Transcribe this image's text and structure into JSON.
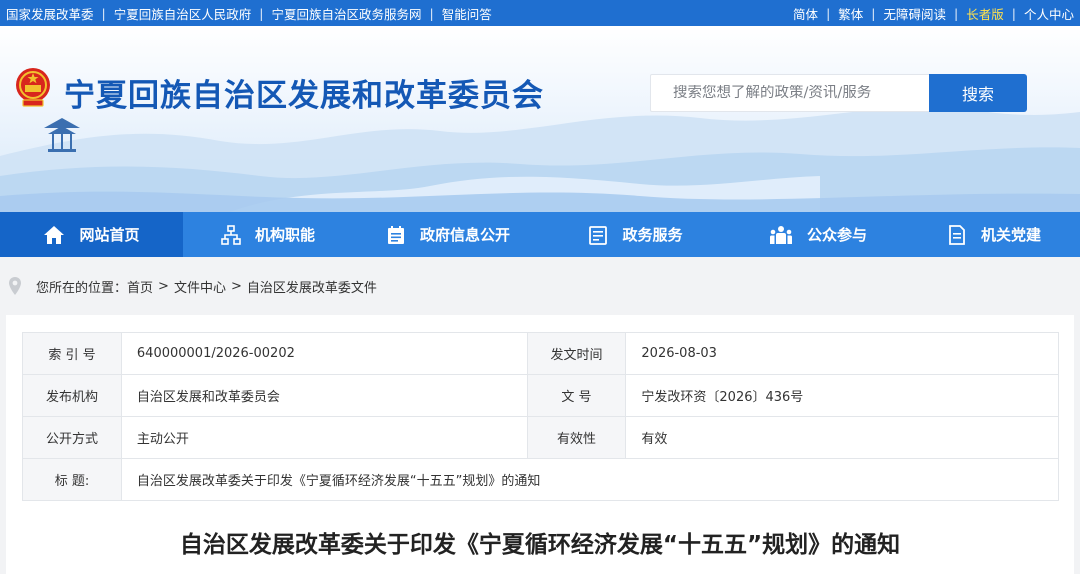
{
  "topbar": {
    "left_links": [
      {
        "label": "国家发展改革委"
      },
      {
        "label": "宁夏回族自治区人民政府"
      },
      {
        "label": "宁夏回族自治区政务服务网"
      },
      {
        "label": "智能问答"
      }
    ],
    "right_links": [
      {
        "label": "简体"
      },
      {
        "label": "繁体"
      },
      {
        "label": "无障碍阅读"
      },
      {
        "label": "长者版"
      },
      {
        "label": "个人中心"
      }
    ],
    "separator": "|",
    "colors": {
      "background": "#1f6fd0",
      "highlight": "#ffe14d"
    }
  },
  "header": {
    "site_title": "宁夏回族自治区发展和改革委员会",
    "search_placeholder": "搜索您想了解的政策/资讯/服务",
    "search_button": "搜索",
    "icons": [
      "national-emblem-icon",
      "pavilion-icon"
    ]
  },
  "nav": {
    "items": [
      {
        "label": "网站首页",
        "icon": "home-icon",
        "active": true
      },
      {
        "label": "机构职能",
        "icon": "org-chart-icon",
        "active": false
      },
      {
        "label": "政府信息公开",
        "icon": "calendar-list-icon",
        "active": false
      },
      {
        "label": "政务服务",
        "icon": "list-doc-icon",
        "active": false
      },
      {
        "label": "公众参与",
        "icon": "people-icon",
        "active": false
      },
      {
        "label": "机关党建",
        "icon": "document-icon",
        "active": false
      }
    ],
    "colors": {
      "background": "#2d82e0",
      "active": "#1565c8"
    }
  },
  "breadcrumb": {
    "prefix": "您所在的位置：",
    "items": [
      "首页",
      "文件中心",
      "自治区发展改革委文件"
    ],
    "separator": ">"
  },
  "meta": {
    "rows": [
      [
        {
          "label": "索 引 号",
          "value": "640000001/2026-00202"
        },
        {
          "label": "发文时间",
          "value": "2026-08-03"
        }
      ],
      [
        {
          "label": "发布机构",
          "value": "自治区发展和改革委员会"
        },
        {
          "label": "文 号",
          "value": "宁发改环资〔2026〕436号"
        }
      ],
      [
        {
          "label": "公开方式",
          "value": "主动公开"
        },
        {
          "label": "有效性",
          "value": "有效"
        }
      ]
    ],
    "title_row": {
      "label": "标 题:",
      "value": "自治区发展改革委关于印发《宁夏循环经济发展“十五五”规划》的通知"
    }
  },
  "document": {
    "title": "自治区发展改革委关于印发《宁夏循环经济发展“十五五”规划》的通知"
  }
}
